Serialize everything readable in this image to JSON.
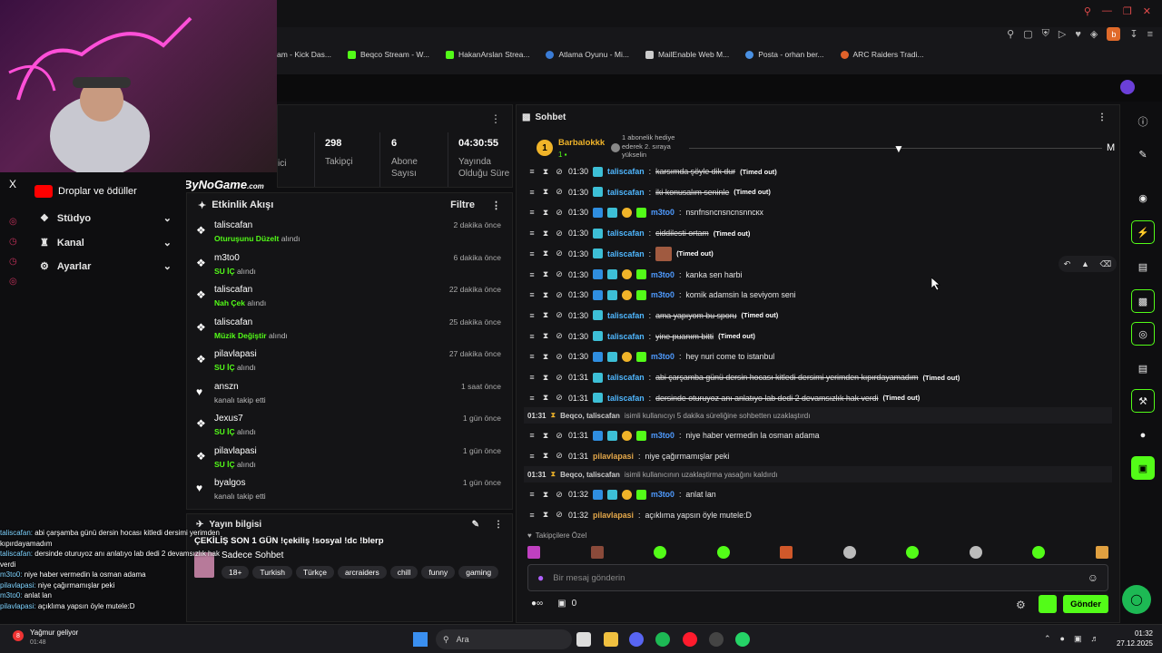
{
  "browser": {
    "bookmarks": [
      "am - Kick Das...",
      "Beqco Stream - W...",
      "HakanArslan Strea...",
      "Atlama Oyunu - Mi...",
      "MailEnable Web M...",
      "Posta - orhan ber...",
      "ARC Raiders Tradi..."
    ]
  },
  "overlay": {
    "brand": "ByNoGame",
    "brand_sub": ".com",
    "menu": [
      {
        "label": "Droplar ve ödüller"
      },
      {
        "label": "Stüdyo"
      },
      {
        "label": "Kanal"
      },
      {
        "label": "Ayarlar"
      }
    ],
    "x_logo": "X",
    "stream_chat": [
      {
        "user": "taliscafan:",
        "text": "abi çarşamba günü dersin hocası kitledi dersimi yerimden kıpırdayamadım"
      },
      {
        "user": "taliscafan:",
        "text": "dersinde oturuyoz anı anlatıyo lab dedi 2 devamsızlık hak verdi"
      },
      {
        "user": "m3to0:",
        "text": "niye haber vermedin la osman adama"
      },
      {
        "user": "pilavlapasi:",
        "text": "niye çağırmamışlar peki"
      },
      {
        "user": "m3to0:",
        "text": "anlat lan"
      },
      {
        "user": "pilavlapasi:",
        "text": "açıklıma yapsın öyle mutele:D"
      }
    ]
  },
  "stats": {
    "partial_label": "ici",
    "followers": {
      "value": "298",
      "label": "Takipçi"
    },
    "subs": {
      "value": "6",
      "label": "Abone Sayısı"
    },
    "uptime": {
      "value": "04:30:55",
      "label": "Yayında Olduğu Süre"
    }
  },
  "activity": {
    "title": "Etkinlik Akışı",
    "filter": "Filtre",
    "items": [
      {
        "user": "taliscafan",
        "reward": "Oturuşunu Düzelt",
        "suffix": "alındı",
        "time": "2 dakika önce",
        "icon": "reward"
      },
      {
        "user": "m3to0",
        "reward": "SU İÇ",
        "suffix": "alındı",
        "time": "6 dakika önce",
        "icon": "reward"
      },
      {
        "user": "taliscafan",
        "reward": "Nah Çek",
        "suffix": "alındı",
        "time": "22 dakika önce",
        "icon": "reward"
      },
      {
        "user": "taliscafan",
        "reward": "Müzik Değiştir",
        "suffix": "alındı",
        "time": "25 dakika önce",
        "icon": "reward"
      },
      {
        "user": "pilavlapasi",
        "reward": "SU İÇ",
        "suffix": "alındı",
        "time": "27 dakika önce",
        "icon": "reward"
      },
      {
        "user": "anszn",
        "reward": "",
        "suffix": "kanalı takip etti",
        "time": "1 saat önce",
        "icon": "heart"
      },
      {
        "user": "Jexus7",
        "reward": "SU İÇ",
        "suffix": "alındı",
        "time": "1 gün önce",
        "icon": "reward"
      },
      {
        "user": "pilavlapasi",
        "reward": "SU İÇ",
        "suffix": "alındı",
        "time": "1 gün önce",
        "icon": "reward"
      },
      {
        "user": "byalgos",
        "reward": "",
        "suffix": "kanalı takip etti",
        "time": "1 gün önce",
        "icon": "heart"
      }
    ]
  },
  "info": {
    "title": "Yayın bilgisi",
    "stream_title": "ÇEKİLİŞ SON 1 GÜN !çekiliş !sosyal !dc !blerp",
    "category": "Sadece Sohbet",
    "tags": [
      "18+",
      "Turkish",
      "Türkçe",
      "arcraiders",
      "chill",
      "funny",
      "gaming"
    ]
  },
  "chat": {
    "title": "Sohbet",
    "pinned_user": "Barbalokkk",
    "pinned_rank": "1",
    "gift_text": "1 abonelik hediye ederek 2. sıraya yükselin",
    "messages": [
      {
        "time": "01:30",
        "user": "taliscafan",
        "text": "karsımda şöyle dik dur",
        "timed_out": true,
        "type": "t"
      },
      {
        "time": "01:30",
        "user": "taliscafan",
        "text": "iki konusalım seninle",
        "timed_out": true,
        "type": "t"
      },
      {
        "time": "01:30",
        "user": "m3to0",
        "text": "nsnfnsncnsncnsnncкx",
        "timed_out": false,
        "type": "m"
      },
      {
        "time": "01:30",
        "user": "taliscafan",
        "text": "ciddilesti ortam",
        "timed_out": true,
        "type": "t"
      },
      {
        "time": "01:30",
        "user": "taliscafan",
        "text": "",
        "timed_out": true,
        "type": "t"
      },
      {
        "time": "01:30",
        "user": "m3to0",
        "text": "kanka sen harbi",
        "timed_out": false,
        "type": "m"
      },
      {
        "time": "01:30",
        "user": "m3to0",
        "text": "komik adamsin la seviyom seni",
        "timed_out": false,
        "type": "m"
      },
      {
        "time": "01:30",
        "user": "taliscafan",
        "text": "ama yapıyom bu sporu",
        "timed_out": true,
        "type": "t"
      },
      {
        "time": "01:30",
        "user": "taliscafan",
        "text": "yine puanım bitti",
        "timed_out": true,
        "type": "t"
      },
      {
        "time": "01:30",
        "user": "m3to0",
        "text": "hey nuri come to istanbul",
        "timed_out": false,
        "type": "m"
      },
      {
        "time": "01:31",
        "user": "taliscafan",
        "text": "abi çarşamba günü dersin hocası kitledi dersimi yerimden kıpırdayamadım",
        "timed_out": true,
        "type": "t"
      },
      {
        "time": "01:31",
        "user": "taliscafan",
        "text": "dersinde oturuyoz anı anlatıyo lab dedi 2 devamsızlık hak verdi",
        "timed_out": true,
        "type": "t"
      }
    ],
    "timed_out_label": "(Timed out)",
    "sys1": {
      "time": "01:31",
      "users": "Beqco, taliscafan",
      "text": "isimli kullanıcıyı 5 dakika süreliğine sohbetten uzaklaştırdı"
    },
    "messages2": [
      {
        "time": "01:31",
        "user": "m3to0",
        "text": "niye haber vermedin la osman adama",
        "type": "m"
      },
      {
        "time": "01:31",
        "user": "pilavlapasi",
        "text": "niye çağırmamışlar peki",
        "type": "p"
      }
    ],
    "sys2": {
      "time": "01:31",
      "users": "Beqco, taliscafan",
      "text": "isimli kullanıcının uzaklaştirma yasağını kaldırdı"
    },
    "messages3": [
      {
        "time": "01:32",
        "user": "m3to0",
        "text": "anlat lan",
        "type": "m"
      },
      {
        "time": "01:32",
        "user": "pilavlapasi",
        "text": "açıklıma yapsın öyle mutele:D",
        "type": "p"
      }
    ],
    "followers_only": "Takipçilere Özel",
    "input_placeholder": "Bir mesaj gönderin",
    "points": "0",
    "send": "Gönder",
    "m_label": "M"
  },
  "taskbar": {
    "weather": "Yağmur geliyor",
    "weather_time": "01:48",
    "weather_badge": "8",
    "search": "Ara",
    "clock_time": "01:32",
    "clock_date": "27.12.2025"
  }
}
